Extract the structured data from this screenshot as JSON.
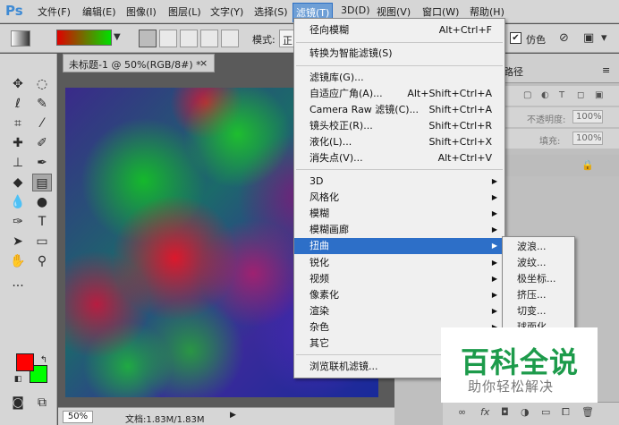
{
  "app": {
    "logo": "Ps"
  },
  "menubar": {
    "items": [
      "文件(F)",
      "编辑(E)",
      "图像(I)",
      "图层(L)",
      "文字(Y)",
      "选择(S)",
      "滤镜(T)",
      "3D(D)",
      "视图(V)",
      "窗口(W)",
      "帮助(H)"
    ],
    "active": "滤镜(T)"
  },
  "options": {
    "gradient_colors": [
      "#ff0000",
      "#00ff00"
    ],
    "mode_label": "模式:",
    "mode_value": "正",
    "dither_checked": "✔",
    "dither_label": "仿色"
  },
  "toolbar": {
    "fg_color": "#ff0000",
    "bg_color": "#00ff00"
  },
  "document": {
    "tab_title": "未标题-1 @ 50%(RGB/8#) *",
    "close": "×",
    "zoom": "50%",
    "doc_size": "文档:1.83M/1.83M"
  },
  "panels": {
    "tab_label": "路径",
    "opacity_label": "不透明度:",
    "opacity_value": "100%",
    "fill_label": "填充:",
    "fill_value": "100%"
  },
  "filter_menu": {
    "items": [
      {
        "label": "径向模糊",
        "shortcut": "Alt+Ctrl+F"
      },
      {
        "label": "转换为智能滤镜(S)",
        "shortcut": ""
      },
      {
        "label": "滤镜库(G)...",
        "shortcut": ""
      },
      {
        "label": "自适应广角(A)...",
        "shortcut": "Alt+Shift+Ctrl+A"
      },
      {
        "label": "Camera Raw 滤镜(C)...",
        "shortcut": "Shift+Ctrl+A"
      },
      {
        "label": "镜头校正(R)...",
        "shortcut": "Shift+Ctrl+R"
      },
      {
        "label": "液化(L)...",
        "shortcut": "Shift+Ctrl+X"
      },
      {
        "label": "消失点(V)...",
        "shortcut": "Alt+Ctrl+V"
      },
      {
        "label": "3D",
        "shortcut": ""
      },
      {
        "label": "风格化",
        "shortcut": ""
      },
      {
        "label": "模糊",
        "shortcut": ""
      },
      {
        "label": "模糊画廊",
        "shortcut": ""
      },
      {
        "label": "扭曲",
        "shortcut": ""
      },
      {
        "label": "锐化",
        "shortcut": ""
      },
      {
        "label": "视频",
        "shortcut": ""
      },
      {
        "label": "像素化",
        "shortcut": ""
      },
      {
        "label": "渲染",
        "shortcut": ""
      },
      {
        "label": "杂色",
        "shortcut": ""
      },
      {
        "label": "其它",
        "shortcut": ""
      },
      {
        "label": "浏览联机滤镜...",
        "shortcut": ""
      }
    ],
    "highlighted": "扭曲",
    "submenu_arrow": "▶"
  },
  "distort_submenu": {
    "items": [
      "波浪...",
      "波纹...",
      "极坐标...",
      "挤压...",
      "切变...",
      "球面化..."
    ]
  },
  "watermark": {
    "title": "百科全说",
    "subtitle": "助你轻松解决"
  },
  "colors": {
    "menu_highlight": "#2d6fc8",
    "watermark_green": "#1d9b4b"
  }
}
